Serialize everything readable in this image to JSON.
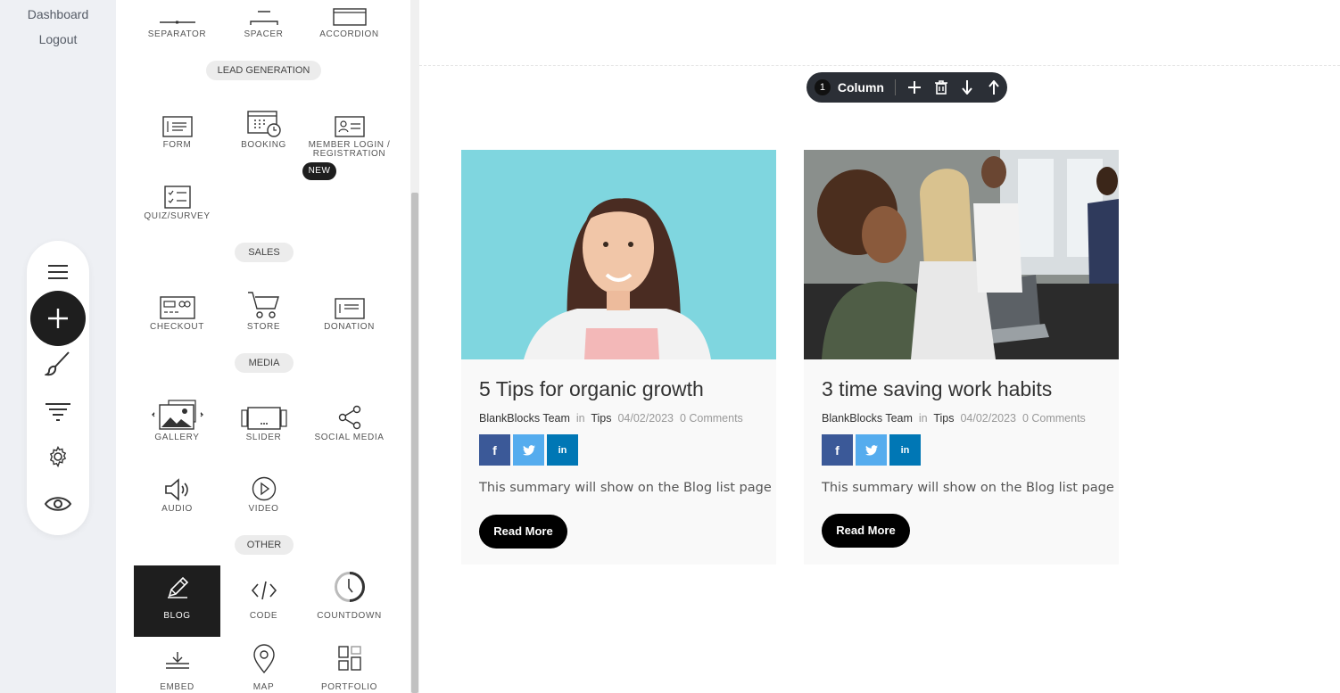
{
  "nav": {
    "dashboard": "Dashboard",
    "logout": "Logout"
  },
  "toolbar": {
    "items": [
      "menu-icon",
      "add-icon",
      "brush-icon",
      "filter-icon",
      "gear-icon",
      "eye-icon"
    ]
  },
  "panel": {
    "top_items": [
      "SEPARATOR",
      "SPACER",
      "ACCORDION"
    ],
    "sections": {
      "lead": "LEAD GENERATION",
      "sales": "SALES",
      "media": "MEDIA",
      "other": "OTHER"
    },
    "lead_items": [
      "FORM",
      "BOOKING",
      "MEMBER LOGIN /",
      "REGISTRATION",
      "QUIZ/SURVEY"
    ],
    "new_badge": "NEW",
    "sales_items": [
      "CHECKOUT",
      "STORE",
      "DONATION"
    ],
    "media_items": [
      "GALLERY",
      "SLIDER",
      "SOCIAL MEDIA",
      "AUDIO",
      "VIDEO"
    ],
    "other_items": [
      "BLOG",
      "CODE",
      "COUNTDOWN",
      "EMBED",
      "MAP",
      "PORTFOLIO"
    ]
  },
  "column_toolbar": {
    "number": "1",
    "label": "Column"
  },
  "posts": [
    {
      "title": "5 Tips for organic growth",
      "author": "BlankBlocks Team",
      "in": "in",
      "category": "Tips",
      "date": "04/02/2023",
      "comments": "0 Comments",
      "summary": "This summary will show on the Blog list page",
      "button": "Read More"
    },
    {
      "title": "3 time saving work habits",
      "author": "BlankBlocks Team",
      "in": "in",
      "category": "Tips",
      "date": "04/02/2023",
      "comments": "0 Comments",
      "summary": "This summary will show on the Blog list page",
      "button": "Read More"
    }
  ],
  "social": {
    "facebook": "f",
    "linkedin": "in"
  },
  "colors": {
    "facebook": "#3b5998",
    "twitter": "#55acee",
    "linkedin": "#0077b5",
    "dark": "#1e1e1e",
    "photo1_bg": "#7fd6df",
    "photo2_bg": "#8a8f8c"
  }
}
